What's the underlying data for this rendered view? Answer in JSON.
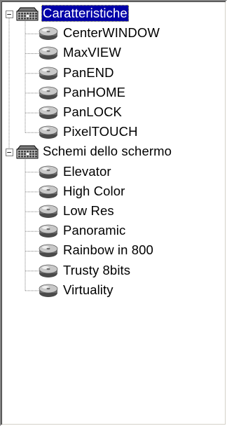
{
  "tree": {
    "groups": [
      {
        "label": "Caratteristiche",
        "expanded": true,
        "selected": true,
        "icon": "keyboard-folder-icon",
        "items": [
          {
            "label": "CenterWINDOW",
            "icon": "disk-icon"
          },
          {
            "label": "MaxVIEW",
            "icon": "disk-icon"
          },
          {
            "label": "PanEND",
            "icon": "disk-icon"
          },
          {
            "label": "PanHOME",
            "icon": "disk-icon"
          },
          {
            "label": "PanLOCK",
            "icon": "disk-icon"
          },
          {
            "label": "PixelTOUCH",
            "icon": "disk-icon"
          }
        ]
      },
      {
        "label": "Schemi dello schermo",
        "expanded": true,
        "selected": false,
        "icon": "keyboard-folder-icon",
        "items": [
          {
            "label": "Elevator",
            "icon": "disk-icon"
          },
          {
            "label": "High Color",
            "icon": "disk-icon"
          },
          {
            "label": "Low Res",
            "icon": "disk-icon"
          },
          {
            "label": "Panoramic",
            "icon": "disk-icon"
          },
          {
            "label": "Rainbow in 800",
            "icon": "disk-icon"
          },
          {
            "label": "Trusty 8bits",
            "icon": "disk-icon"
          },
          {
            "label": "Virtuality",
            "icon": "disk-icon"
          }
        ]
      }
    ],
    "toggle_expanded_symbol": "−",
    "colors": {
      "selection_bg": "#0000a8",
      "selection_fg": "#ffffff",
      "background": "#ffffff",
      "lines": "#808080"
    }
  }
}
